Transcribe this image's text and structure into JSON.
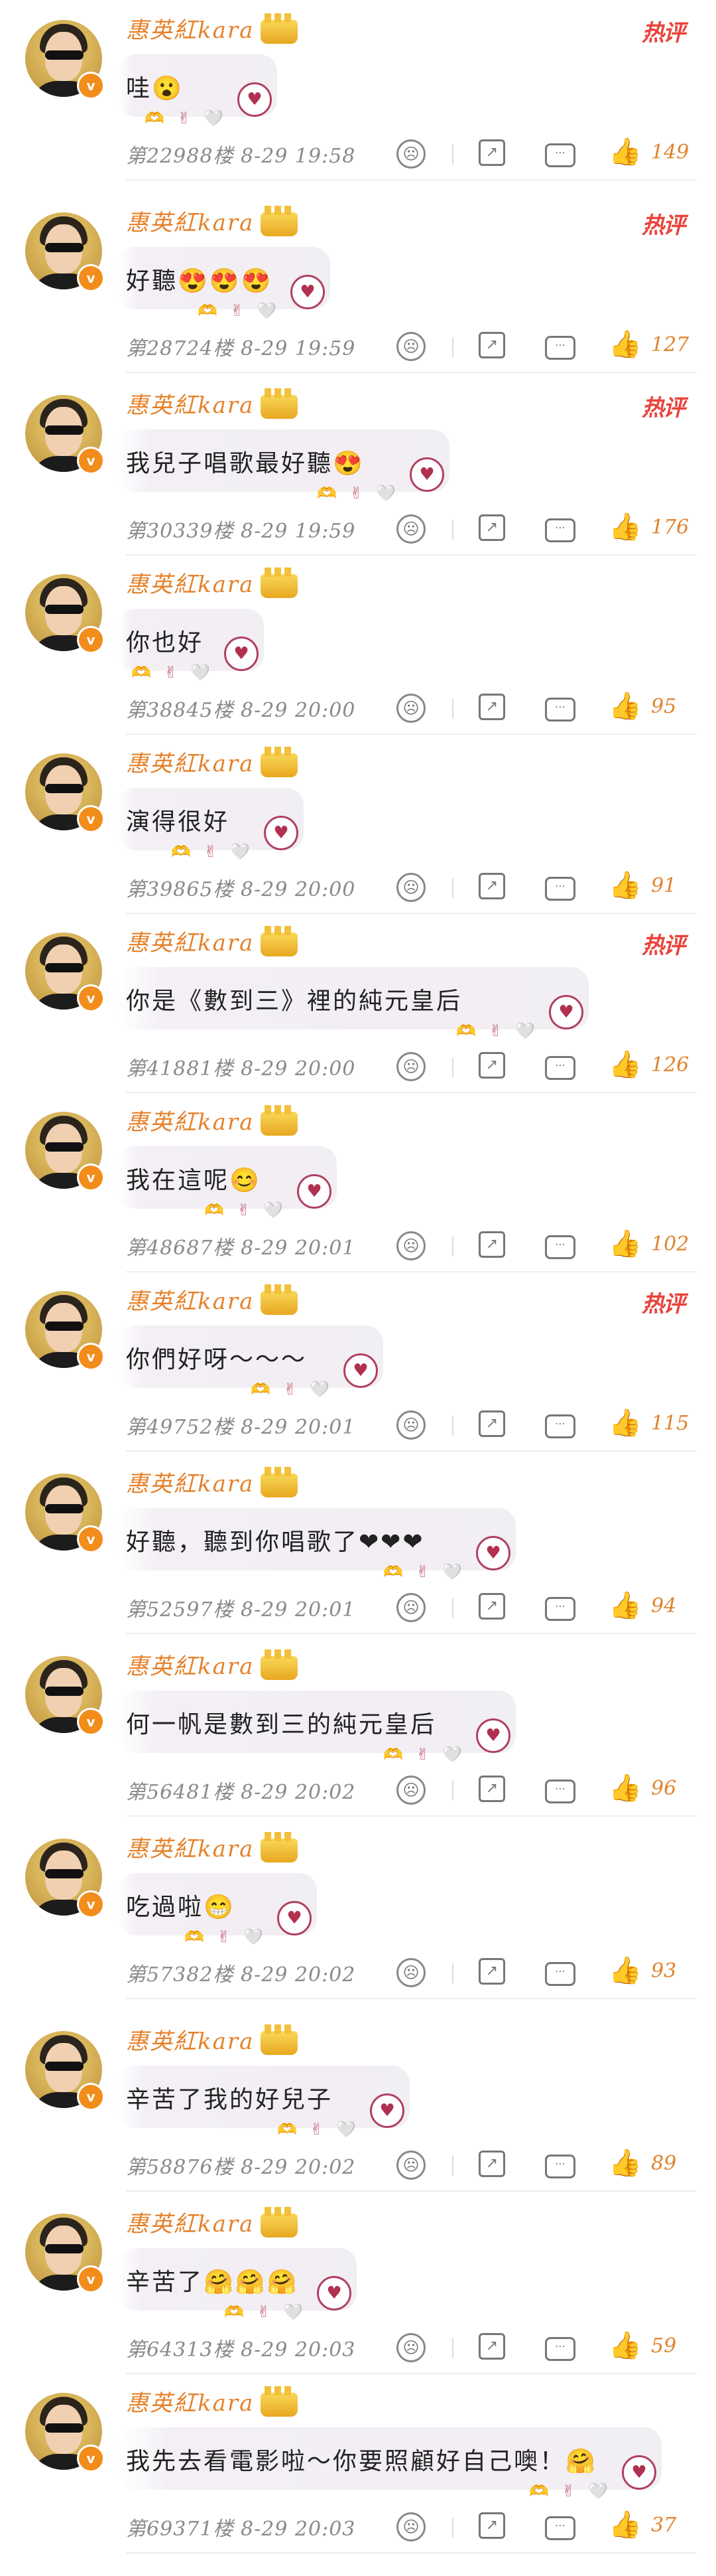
{
  "colors": {
    "username": "#e5812a",
    "hot": "#e8443c",
    "like": "#f2962b",
    "badge": "#f28c1b"
  },
  "icons": {
    "badge": "v",
    "sad": "☹",
    "share": "↗",
    "comment": "⋯",
    "like": "👍",
    "heart": "♥",
    "deco": "🫶 ✌ 🤍"
  },
  "comments": [
    {
      "username": "惠英紅kara",
      "hot": "热评",
      "text": "哇😮",
      "floor": "第22988楼",
      "time": "8-29 19:58",
      "likes": "149"
    },
    {
      "username": "惠英紅kara",
      "hot": "热评",
      "text": "好聽😍😍😍",
      "floor": "第28724楼",
      "time": "8-29 19:59",
      "likes": "127"
    },
    {
      "username": "惠英紅kara",
      "hot": "热评",
      "text": "我兒子唱歌最好聽😍",
      "floor": "第30339楼",
      "time": "8-29 19:59",
      "likes": "176"
    },
    {
      "username": "惠英紅kara",
      "hot": "",
      "text": "你也好",
      "floor": "第38845楼",
      "time": "8-29 20:00",
      "likes": "95"
    },
    {
      "username": "惠英紅kara",
      "hot": "",
      "text": "演得很好",
      "floor": "第39865楼",
      "time": "8-29 20:00",
      "likes": "91"
    },
    {
      "username": "惠英紅kara",
      "hot": "热评",
      "text": "你是《數到三》裡的純元皇后",
      "floor": "第41881楼",
      "time": "8-29 20:00",
      "likes": "126"
    },
    {
      "username": "惠英紅kara",
      "hot": "",
      "text": "我在這呢😊",
      "floor": "第48687楼",
      "time": "8-29 20:01",
      "likes": "102"
    },
    {
      "username": "惠英紅kara",
      "hot": "热评",
      "text": "你們好呀～～～",
      "floor": "第49752楼",
      "time": "8-29 20:01",
      "likes": "115"
    },
    {
      "username": "惠英紅kara",
      "hot": "",
      "text": "好聽，聽到你唱歌了❤❤❤",
      "floor": "第52597楼",
      "time": "8-29 20:01",
      "likes": "94"
    },
    {
      "username": "惠英紅kara",
      "hot": "",
      "text": "何一帆是數到三的純元皇后",
      "floor": "第56481楼",
      "time": "8-29 20:02",
      "likes": "96"
    },
    {
      "username": "惠英紅kara",
      "hot": "",
      "text": "吃過啦😁",
      "floor": "第57382楼",
      "time": "8-29 20:02",
      "likes": "93"
    },
    {
      "username": "惠英紅kara",
      "hot": "",
      "text": "辛苦了我的好兒子",
      "floor": "第58876楼",
      "time": "8-29 20:02",
      "likes": "89"
    },
    {
      "username": "惠英紅kara",
      "hot": "",
      "text": "辛苦了🤗🤗🤗",
      "floor": "第64313楼",
      "time": "8-29 20:03",
      "likes": "59"
    },
    {
      "username": "惠英紅kara",
      "hot": "",
      "text": "我先去看電影啦～你要照顧好自己噢！🤗",
      "floor": "第69371楼",
      "time": "8-29 20:03",
      "likes": "37"
    }
  ]
}
